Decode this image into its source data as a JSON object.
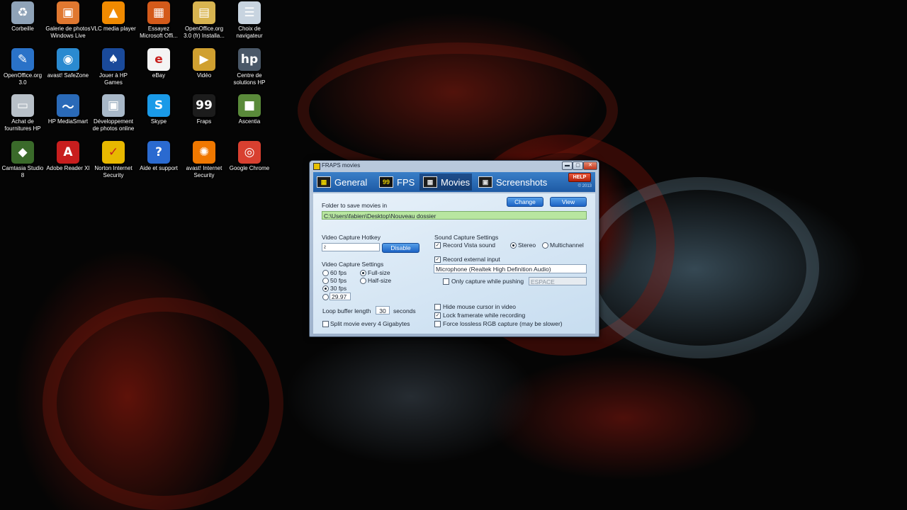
{
  "desktop": {
    "icons": [
      {
        "label": "Corbeille",
        "icon": "recycle-bin-icon",
        "glyph": "♻",
        "color": "#8fa3b8"
      },
      {
        "label": "Galerie de photos\nWindows Live",
        "icon": "photo-gallery-icon",
        "glyph": "▣",
        "color": "#e07830"
      },
      {
        "label": "VLC media player",
        "icon": "vlc-cone-icon",
        "glyph": "▲",
        "color": "#f08a00"
      },
      {
        "label": "Essayez\nMicrosoft Offi...",
        "icon": "office-icon",
        "glyph": "▦",
        "color": "#d45a1a"
      },
      {
        "label": "OpenOffice.org\n3.0 (fr) Installa...",
        "icon": "folder-icon",
        "glyph": "▤",
        "color": "#d8b450"
      },
      {
        "label": "Choix de\nnavigateur",
        "icon": "browser-choice-icon",
        "glyph": "☰",
        "color": "#c8d4e0"
      },
      {
        "label": "OpenOffice.org\n3.0",
        "icon": "openoffice-icon",
        "glyph": "✎",
        "color": "#2a72c8"
      },
      {
        "label": "avast! SafeZone",
        "icon": "safezone-icon",
        "glyph": "◉",
        "color": "#2a8ad0"
      },
      {
        "label": "Jouer à HP\nGames",
        "icon": "hp-games-icon",
        "glyph": "♠",
        "color": "#1a4a9a"
      },
      {
        "label": "eBay",
        "icon": "ebay-icon",
        "glyph": "e",
        "color": "#f4f4f4"
      },
      {
        "label": "Vidéo",
        "icon": "video-folder-icon",
        "glyph": "▶",
        "color": "#d0a030"
      },
      {
        "label": "Centre de\nsolutions HP",
        "icon": "hp-solutions-icon",
        "glyph": "hp",
        "color": "#4a5868"
      },
      {
        "label": "Achat de\nfournitures HP",
        "icon": "printer-icon",
        "glyph": "▭",
        "color": "#b8c0c8"
      },
      {
        "label": "HP MediaSmart",
        "icon": "mediasmart-icon",
        "glyph": "〜",
        "color": "#2a6ab8"
      },
      {
        "label": "Développement\nde photos online",
        "icon": "photo-print-icon",
        "glyph": "▣",
        "color": "#a8b8c8"
      },
      {
        "label": "Skype",
        "icon": "skype-icon",
        "glyph": "S",
        "color": "#1a9ae8"
      },
      {
        "label": "Fraps",
        "icon": "fraps-icon",
        "glyph": "99",
        "color": "#1c1c1c"
      },
      {
        "label": "Ascentia",
        "icon": "minecraft-block-icon",
        "glyph": "■",
        "color": "#5a8a3a"
      },
      {
        "label": "Camtasia Studio\n8",
        "icon": "camtasia-icon",
        "glyph": "◆",
        "color": "#3a6a2a"
      },
      {
        "label": "Adobe Reader XI",
        "icon": "adobe-reader-icon",
        "glyph": "A",
        "color": "#c81e1e"
      },
      {
        "label": "Norton Internet\nSecurity",
        "icon": "norton-icon",
        "glyph": "✓",
        "color": "#e8b800"
      },
      {
        "label": "Aide et support",
        "icon": "help-support-icon",
        "glyph": "?",
        "color": "#2a6ad0"
      },
      {
        "label": "avast! Internet\nSecurity",
        "icon": "avast-icon",
        "glyph": "✺",
        "color": "#f07800"
      },
      {
        "label": "Google Chrome",
        "icon": "chrome-icon",
        "glyph": "◎",
        "color": "#d84030"
      }
    ]
  },
  "window": {
    "title": "FRAPS movies",
    "buttons": {
      "minimize": "▬",
      "maximize": "▢",
      "close": "✕"
    },
    "help": "HELP",
    "copyright": "© 2013",
    "tabs": [
      {
        "label": "General",
        "glyph": "▦"
      },
      {
        "label": "FPS",
        "glyph": "99"
      },
      {
        "label": "Movies",
        "glyph": "▦"
      },
      {
        "label": "Screenshots",
        "glyph": "▣"
      }
    ],
    "active_tab": "Movies"
  },
  "movies": {
    "folder_label": "Folder to save movies in",
    "folder_path": "C:\\Users\\fabien\\Desktop\\Nouveau dossier",
    "change_button": "Change",
    "view_button": "View",
    "hotkey_label": "Video Capture Hotkey",
    "hotkey_value": "²",
    "disable_button": "Disable",
    "capture_settings_label": "Video Capture Settings",
    "fps_options": [
      {
        "label": "60 fps",
        "selected": false
      },
      {
        "label": "50 fps",
        "selected": false
      },
      {
        "label": "30 fps",
        "selected": true
      }
    ],
    "custom_fps_value": "29.97",
    "size_options": [
      {
        "label": "Full-size",
        "selected": true
      },
      {
        "label": "Half-size",
        "selected": false
      }
    ],
    "loop_buffer_label": "Loop buffer length",
    "loop_buffer_value": "30",
    "loop_buffer_unit": "seconds",
    "split_movie_label": "Split movie every 4 Gigabytes",
    "split_movie_checked": false,
    "sound_settings_label": "Sound Capture Settings",
    "record_vista_label": "Record Vista sound",
    "record_vista_checked": true,
    "stereo_label": "Stereo",
    "stereo_selected": true,
    "multichannel_label": "Multichannel",
    "multichannel_selected": false,
    "record_external_label": "Record external input",
    "record_external_checked": true,
    "input_device": "Microphone (Realtek High Definition Audio)",
    "only_capture_label": "Only capture while pushing",
    "only_capture_checked": false,
    "push_key_value": "ESPACE",
    "hide_cursor_label": "Hide mouse cursor in video",
    "hide_cursor_checked": false,
    "lock_framerate_label": "Lock framerate while recording",
    "lock_framerate_checked": true,
    "force_lossless_label": "Force lossless RGB capture (may be slower)",
    "force_lossless_checked": false,
    "check_mark": "✓"
  }
}
